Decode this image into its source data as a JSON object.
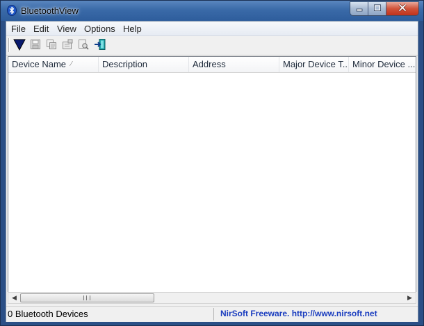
{
  "window": {
    "title": "BluetoothView",
    "app_icon": "bluetooth-icon",
    "controls": {
      "minimize": "minimize-icon",
      "maximize": "maximize-icon",
      "close": "close-icon"
    }
  },
  "menu": {
    "items": [
      "File",
      "Edit",
      "View",
      "Options",
      "Help"
    ]
  },
  "toolbar": {
    "buttons": [
      {
        "name": "start-stop-icon",
        "enabled": true
      },
      {
        "name": "save-icon",
        "enabled": false
      },
      {
        "name": "copy-icon",
        "enabled": false
      },
      {
        "name": "properties-icon",
        "enabled": false
      },
      {
        "name": "find-icon",
        "enabled": false
      },
      {
        "name": "exit-icon",
        "enabled": true
      }
    ]
  },
  "list": {
    "columns": [
      "Device Name",
      "Description",
      "Address",
      "Major Device T...",
      "Minor Device ..."
    ],
    "sort_column": "Device Name",
    "rows": []
  },
  "status": {
    "count_text": "0 Bluetooth Devices",
    "credit_text": "NirSoft Freeware.  http://www.nirsoft.net",
    "credit_color": "#1a3dbf"
  }
}
